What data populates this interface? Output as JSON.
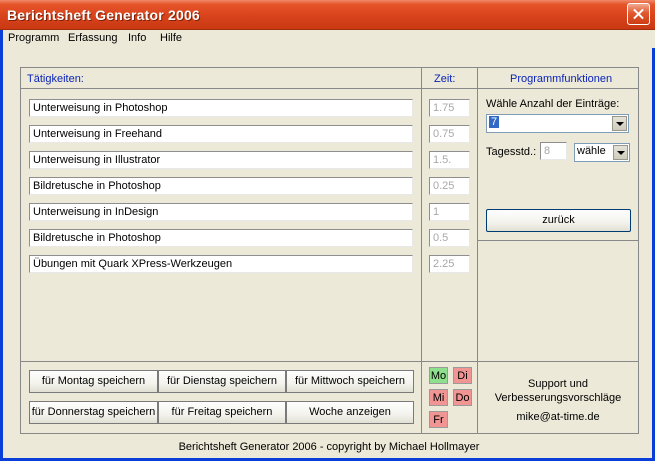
{
  "window": {
    "title": "Berichtsheft Generator 2006"
  },
  "menu": [
    "Programm",
    "Erfassung",
    "Info",
    "Hilfe"
  ],
  "activities": {
    "header": "Tätigkeiten:",
    "items": [
      "Unterweisung in Photoshop",
      "Unterweisung in Freehand",
      "Unterweisung in Illustrator",
      "Bildretusche in Photoshop",
      "Unterweisung in InDesign",
      "Bildretusche in Photoshop",
      "Übungen mit Quark XPress-Werkzeugen"
    ]
  },
  "time": {
    "header": "Zeit:",
    "values": [
      "1.75",
      "0.75",
      "1.5.",
      "0.25",
      "1",
      "0.5",
      "2.25"
    ]
  },
  "functions": {
    "header": "Programmfunktionen",
    "count_label": "Wähle Anzahl der Einträge:",
    "count_value": "7",
    "hours_label": "Tagesstd.:",
    "hours_value": "8",
    "choose_value": "wähle",
    "back_button": "zurück"
  },
  "save_buttons": {
    "monday": "für Montag speichern",
    "tuesday": "für Dienstag speichern",
    "wednesday": "für Mittwoch speichern",
    "thursday": "für Donnerstag speichern",
    "friday": "für Freitag speichern",
    "week": "Woche anzeigen"
  },
  "days": {
    "mo": "Mo",
    "di": "Di",
    "mi": "Mi",
    "do": "Do",
    "fr": "Fr",
    "done_color": "#8fe08c",
    "todo_color": "#f09494"
  },
  "support": {
    "line1": "Support und",
    "line2": "Verbesserungsvorschläge",
    "email": "mike@at-time.de"
  },
  "footer": "Berichtsheft Generator 2006 - copyright by Michael Hollmayer"
}
